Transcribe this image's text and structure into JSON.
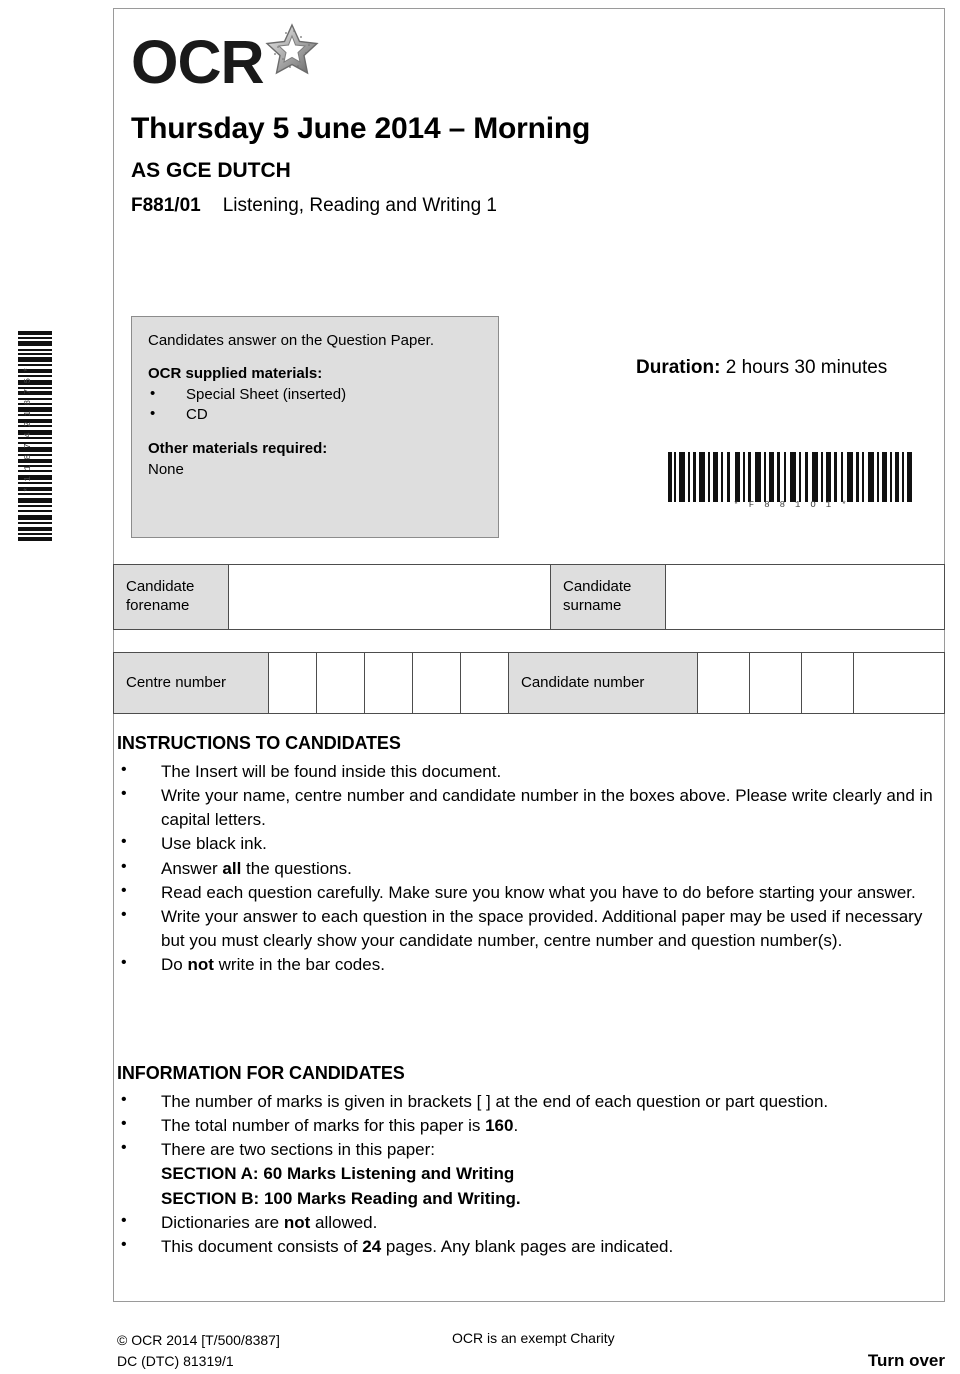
{
  "header": {
    "logo_text": "OCR",
    "logo_star_icon": "star-icon",
    "exam_date": "Thursday 5 June 2014 – Morning",
    "qualification": "AS GCE  DUTCH",
    "paper_code": "F881/01",
    "paper_name": "Listening, Reading and Writing 1"
  },
  "materials": {
    "answer_note": "Candidates answer on the Question Paper.",
    "supplied_heading": "OCR supplied materials:",
    "supplied_items": [
      "Special Sheet (inserted)",
      "CD"
    ],
    "other_heading": "Other materials required:",
    "other_value": "None"
  },
  "duration": {
    "label": "Duration:",
    "value": "2 hours 30 minutes"
  },
  "barcodes": {
    "vertical_value": "*1187421875*",
    "vertical_digits": "1 1 8 7 4 2 1 8 7 5",
    "horizontal_value": "*F881O1*",
    "horizontal_digits": "F 8 8 1 O 1"
  },
  "candidate_fields": {
    "forename_label": "Candidate\nforename",
    "forename_label_line1": "Candidate",
    "forename_label_line2": "forename",
    "surname_label_line1": "Candidate",
    "surname_label_line2": "surname",
    "centre_number_label": "Centre number",
    "candidate_number_label": "Candidate number",
    "forename_value": "",
    "surname_value": "",
    "centre_number_cells": [
      "",
      "",
      "",
      "",
      ""
    ],
    "candidate_number_cells": [
      "",
      "",
      "",
      ""
    ]
  },
  "instructions": {
    "heading": "INSTRUCTIONS TO CANDIDATES",
    "items": [
      "The Insert will be found inside this document.",
      "Write your name, centre number and candidate number in the boxes above. Please write clearly and in capital letters.",
      "Use black ink.",
      "Answer all the questions.",
      "Read each question carefully. Make sure you know what you have to do before starting your answer.",
      "Write your answer to each question in the space provided. Additional paper may be used if necessary but you must clearly show your candidate number, centre number and question number(s).",
      "Do not write in the bar codes."
    ]
  },
  "information": {
    "heading": "INFORMATION FOR CANDIDATES",
    "items": [
      "The number of marks is given in brackets [  ] at the end of each question or part question.",
      "The total number of marks for this paper is 160.",
      "There are two sections in this paper:",
      "Dictionaries are not allowed.",
      "This document consists of 24 pages. Any blank pages are indicated."
    ],
    "section_a": "SECTION A: 60 Marks Listening and Writing",
    "section_b": "SECTION B: 100 Marks Reading and Writing.",
    "total_marks": "160",
    "page_count": "24"
  },
  "footer": {
    "copyright": "© OCR 2014  [T/500/8387]",
    "doc_code": "DC (DTC) 81319/1",
    "charity_note": "OCR is an exempt Charity",
    "turn_over": "Turn over"
  },
  "colors": {
    "grey_fill": "#dedede",
    "frame_border": "#9a9a9a",
    "cell_border": "#4d4d4d",
    "text": "#000000"
  }
}
